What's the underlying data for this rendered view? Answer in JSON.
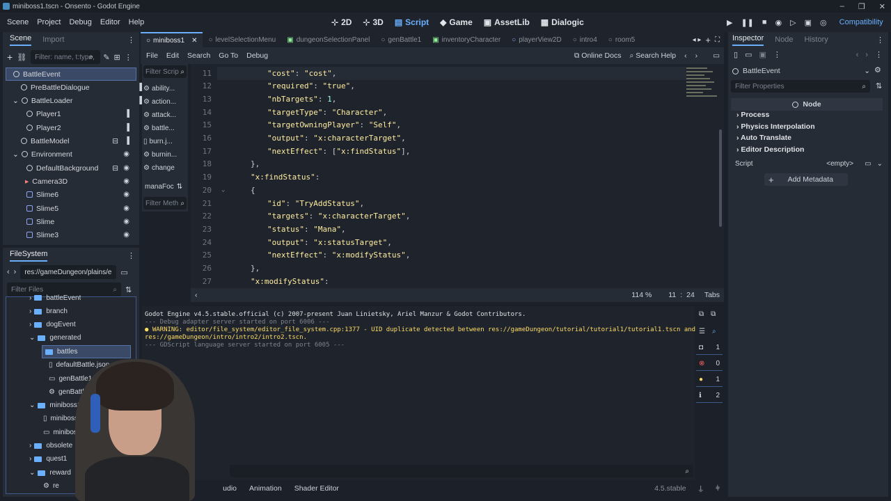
{
  "window": {
    "title": "miniboss1.tscn - Onsento - Godot Engine"
  },
  "menu": [
    "Scene",
    "Project",
    "Debug",
    "Editor",
    "Help"
  ],
  "workspaces": [
    {
      "label": "2D",
      "icon": "2d-icon"
    },
    {
      "label": "3D",
      "icon": "3d-icon"
    },
    {
      "label": "Script",
      "icon": "script-icon"
    },
    {
      "label": "Game",
      "icon": "game-icon"
    },
    {
      "label": "AssetLib",
      "icon": "assetlib-icon"
    },
    {
      "label": "Dialogic",
      "icon": "dialogic-icon"
    }
  ],
  "renderer": "Compatibility",
  "scene_dock": {
    "tabs": [
      "Scene",
      "Import"
    ],
    "filter_placeholder": "Filter: name, t:type, g",
    "nodes": [
      {
        "label": "BattleEvent"
      },
      {
        "label": "PreBattleDialogue"
      },
      {
        "label": "BattleLoader"
      },
      {
        "label": "Player1"
      },
      {
        "label": "Player2"
      },
      {
        "label": "BattleModel"
      },
      {
        "label": "Environment"
      },
      {
        "label": "DefaultBackground"
      },
      {
        "label": "Camera3D"
      },
      {
        "label": "Slime6"
      },
      {
        "label": "Slime5"
      },
      {
        "label": "Slime"
      },
      {
        "label": "Slime3"
      }
    ]
  },
  "filesystem": {
    "title": "FileSystem",
    "path": "res://gameDungeon/plains/e",
    "filter_placeholder": "Filter Files",
    "items": [
      {
        "label": "battleEvent"
      },
      {
        "label": "branch"
      },
      {
        "label": "dogEvent"
      },
      {
        "label": "generated"
      },
      {
        "label": "battles"
      },
      {
        "label": "defaultBattle.json"
      },
      {
        "label": "genBattle1.tscn"
      },
      {
        "label": "genBattle.g"
      },
      {
        "label": "miniboss1"
      },
      {
        "label": "miniboss1"
      },
      {
        "label": "miniboss1"
      },
      {
        "label": "obsolete"
      },
      {
        "label": "quest1"
      },
      {
        "label": "reward"
      },
      {
        "label": "re"
      }
    ]
  },
  "editor_tabs": [
    "miniboss1",
    "levelSelectionMenu",
    "dungeonSelectionPanel",
    "genBattle1",
    "inventoryCharacter",
    "playerView2D",
    "intro4",
    "room5"
  ],
  "script_menu": [
    "File",
    "Edit",
    "Search",
    "Go To",
    "Debug"
  ],
  "online_docs": "Online Docs",
  "search_help": "Search Help",
  "script_list": {
    "filter_placeholder": "Filter Scrip",
    "items": [
      "ability...",
      "action...",
      "attack...",
      "battle...",
      "burn.j...",
      "burnin...",
      "change"
    ],
    "current": "manaFoc",
    "method_filter": "Filter Meth"
  },
  "code_lines": [
    {
      "n": "11",
      "text": "\"cost\": \"cost\","
    },
    {
      "n": "12",
      "text": "\"required\": \"true\","
    },
    {
      "n": "13",
      "text": "\"nbTargets\": 1,"
    },
    {
      "n": "14",
      "text": "\"targetType\": \"Character\","
    },
    {
      "n": "15",
      "text": "\"targetOwningPlayer\": \"Self\","
    },
    {
      "n": "16",
      "text": "\"output\": \"x:characterTarget\","
    },
    {
      "n": "17",
      "text": "\"nextEffect\": [\"x:findStatus\"],"
    },
    {
      "n": "18",
      "text": "},"
    },
    {
      "n": "19",
      "text": "\"x:findStatus\":"
    },
    {
      "n": "20",
      "text": "{"
    },
    {
      "n": "21",
      "text": "\"id\": \"TryAddStatus\","
    },
    {
      "n": "22",
      "text": "\"targets\": \"x:characterTarget\","
    },
    {
      "n": "23",
      "text": "\"status\": \"Mana\","
    },
    {
      "n": "24",
      "text": "\"output\": \"x:statusTarget\","
    },
    {
      "n": "25",
      "text": "\"nextEffect\": \"x:modifyStatus\","
    },
    {
      "n": "26",
      "text": "},"
    },
    {
      "n": "27",
      "text": "\"x:modifyStatus\":"
    }
  ],
  "status_bar": {
    "zoom": "114 %",
    "line": "11",
    "col": "24",
    "indent": "Tabs"
  },
  "output": {
    "lines": [
      "Godot Engine v4.5.stable.official (c) 2007-present Juan Linietsky, Ariel Manzur & Godot Contributors.",
      "--- Debug adapter server started on port 6006 ---",
      "WARNING: editor/file_system/editor_file_system.cpp:1377 - UID duplicate detected between res://gameDungeon/tutorial/tutorial1/tutorial1.tscn and",
      "res://gameDungeon/intro/intro2/intro2.tscn.",
      "--- GDScript language server started on port 6005 ---"
    ],
    "counts": {
      "messages": "1",
      "errors": "0",
      "warnings": "1",
      "info": "2"
    }
  },
  "bottom_tabs": [
    "Audio",
    "Animation",
    "Shader Editor"
  ],
  "version": "4.5.stable",
  "inspector": {
    "tabs": [
      "Inspector",
      "Node",
      "History"
    ],
    "object": "BattleEvent",
    "filter_placeholder": "Filter Properties",
    "header": "Node",
    "sections": [
      "Process",
      "Physics Interpolation",
      "Auto Translate",
      "Editor Description"
    ],
    "script_label": "Script",
    "script_value": "<empty>",
    "add_metadata": "Add Metadata"
  },
  "colors": {
    "accent": "#6ab0ff",
    "panel": "#262c35",
    "bg": "#1c2129",
    "string": "#ffeda1",
    "number": "#a1ffe0",
    "warning": "#ffdd65",
    "error": "#ff5f5f"
  }
}
